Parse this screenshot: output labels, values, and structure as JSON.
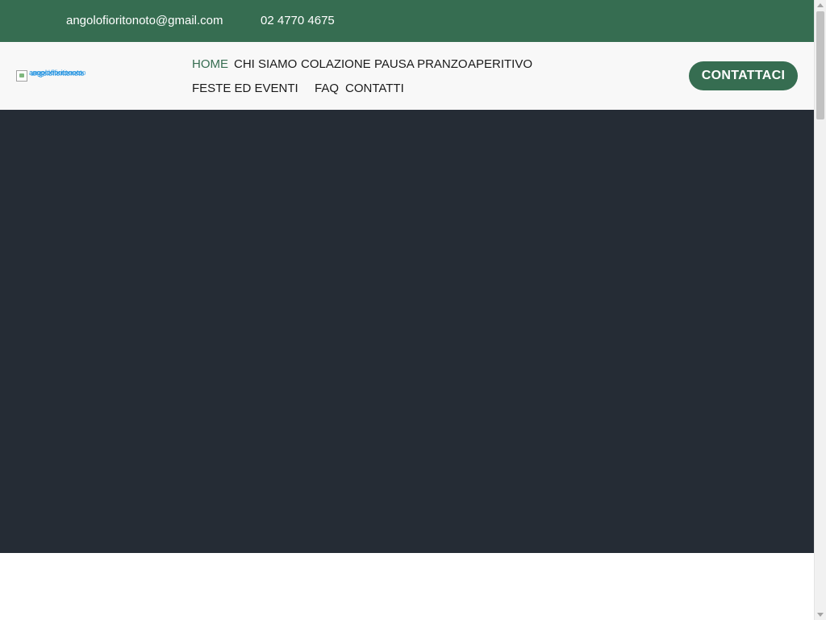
{
  "topbar": {
    "email": "angolofioritonoto@gmail.com",
    "phone": "02 4770 4675"
  },
  "header": {
    "logo_alt": "angolofioritonoto",
    "nav": {
      "home": "HOME",
      "chi_siamo": "CHI SIAMO",
      "colazione": "COLAZIONE",
      "pausa_pranzo": "PAUSA PRANZO",
      "aperitivo": "APERITIVO",
      "feste_eventi": "FESTE ED EVENTI",
      "faq": "FAQ",
      "contatti": "CONTATTI"
    },
    "cta_label": "CONTATTACI"
  },
  "colors": {
    "brand_green": "#366d51",
    "header_bg": "#f8f8f8",
    "hero_bg": "#252c35",
    "link_blue": "#1a8fe0"
  },
  "icons": {
    "logo": "broken-image-icon"
  }
}
